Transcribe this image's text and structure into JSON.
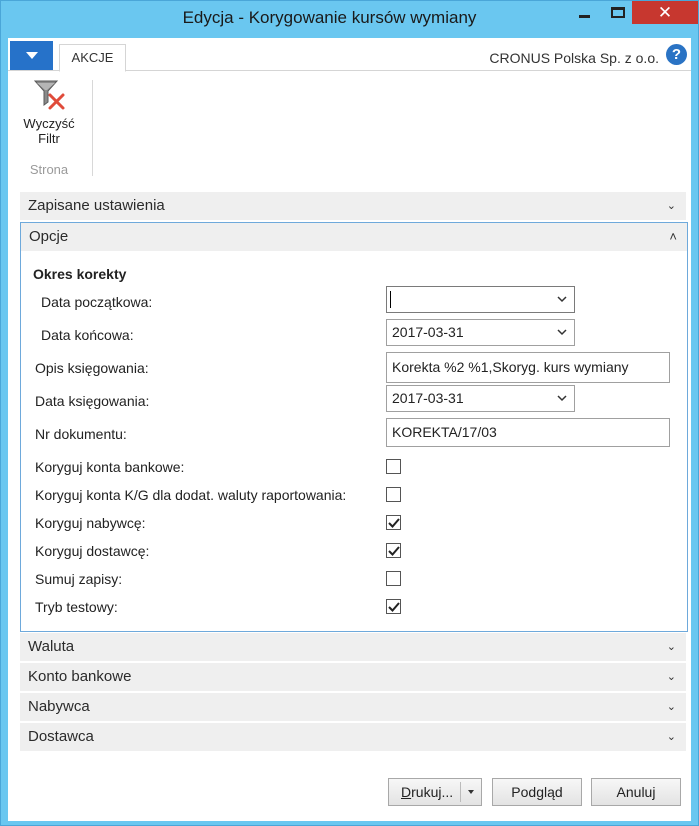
{
  "window": {
    "title": "Edycja - Korygowanie kursów wymiany",
    "close_glyph": "✕"
  },
  "tabs": {
    "akcje": "AKCJE"
  },
  "company": "CRONUS Polska Sp. z o.o.",
  "help_glyph": "?",
  "ribbon": {
    "clear_filter": {
      "line1": "Wyczyść",
      "line2": "Filtr",
      "icon": "clear-filter-icon"
    },
    "group": "Strona"
  },
  "sections": {
    "zapisane": "Zapisane ustawienia",
    "opcje": "Opcje",
    "waluta": "Waluta",
    "konto": "Konto bankowe",
    "nabywca": "Nabywca",
    "dostawca": "Dostawca",
    "chev_down": "⌄",
    "chev_up": "˄"
  },
  "options": {
    "group_title": "Okres korekty",
    "data_poczatkowa": {
      "label": "Data początkowa:",
      "value": ""
    },
    "data_koncowa": {
      "label": "Data końcowa:",
      "value": "2017-03-31"
    },
    "opis": {
      "label": "Opis księgowania:",
      "value": "Korekta %2 %1,Skoryg. kurs wymiany"
    },
    "data_ksieg": {
      "label": "Data księgowania:",
      "value": "2017-03-31"
    },
    "nr_dok": {
      "label": "Nr dokumentu:",
      "value": "KOREKTA/17/03"
    },
    "checkboxes": [
      {
        "label": "Koryguj konta bankowe:",
        "checked": false
      },
      {
        "label": "Koryguj konta K/G dla dodat. waluty raportowania:",
        "checked": false
      },
      {
        "label": "Koryguj nabywcę:",
        "checked": true
      },
      {
        "label": "Koryguj dostawcę:",
        "checked": true
      },
      {
        "label": "Sumuj zapisy:",
        "checked": false
      },
      {
        "label": "Tryb testowy:",
        "checked": true
      }
    ]
  },
  "footer": {
    "drukuj_first": "D",
    "drukuj_rest": "rukuj...",
    "podglad": "Podgląd",
    "anuluj": "Anuluj"
  },
  "colors": {
    "titlebar": "#6ac7f0",
    "close": "#c7372f",
    "app_menu": "#2672c9",
    "section_bg": "#efefef",
    "focus_border": "#6ea9db"
  }
}
